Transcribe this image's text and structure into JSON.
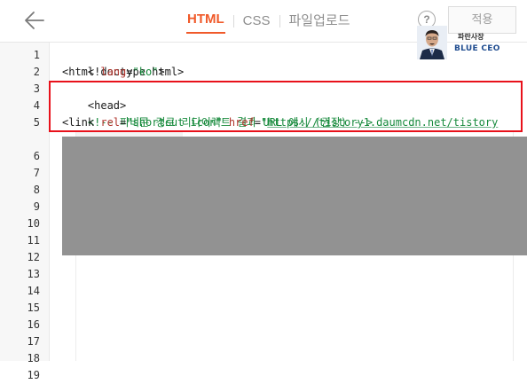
{
  "toolbar": {
    "tabs": [
      {
        "label": "HTML",
        "active": true
      },
      {
        "label": "CSS",
        "active": false
      },
      {
        "label": "파일업로드",
        "active": false
      }
    ],
    "help_label": "?",
    "apply_label": "적용",
    "back_icon": "arrow-left-icon"
  },
  "editor": {
    "line_numbers": [
      "1",
      "2",
      "3",
      "4",
      "5",
      "6",
      "7",
      "8",
      "9",
      "10",
      "11",
      "12",
      "13",
      "14",
      "15",
      "16",
      "17",
      "18",
      "19"
    ],
    "lines": {
      "l1": {
        "text": "<!doctype html>"
      },
      "l2": {
        "open": "<html ",
        "attr": "lang",
        "eq": "=",
        "value": "\"ko\"",
        "close": ">"
      },
      "l3": {
        "text": "<head>"
      },
      "l4": {
        "comment": "<!-- 파비콘 경로 리다이렉트 결과 URL 예시 (권장) -->"
      },
      "l5": {
        "open": "<link ",
        "attr1": "rel",
        "eq1": "=",
        "value1": "\"shortcut icon\"",
        "space": " ",
        "attr2": "href",
        "eq2": "=",
        "quote": "\"",
        "url": "https://tistory1.daumcdn.net/tistory"
      }
    }
  },
  "badge": {
    "title": "파란사장",
    "subtitle": "BLUE CEO"
  },
  "colors": {
    "accent": "#f05a2a",
    "highlight_border": "#e8111b",
    "redaction": "#929292",
    "string": "#178a3c",
    "attribute": "#b0332b"
  }
}
